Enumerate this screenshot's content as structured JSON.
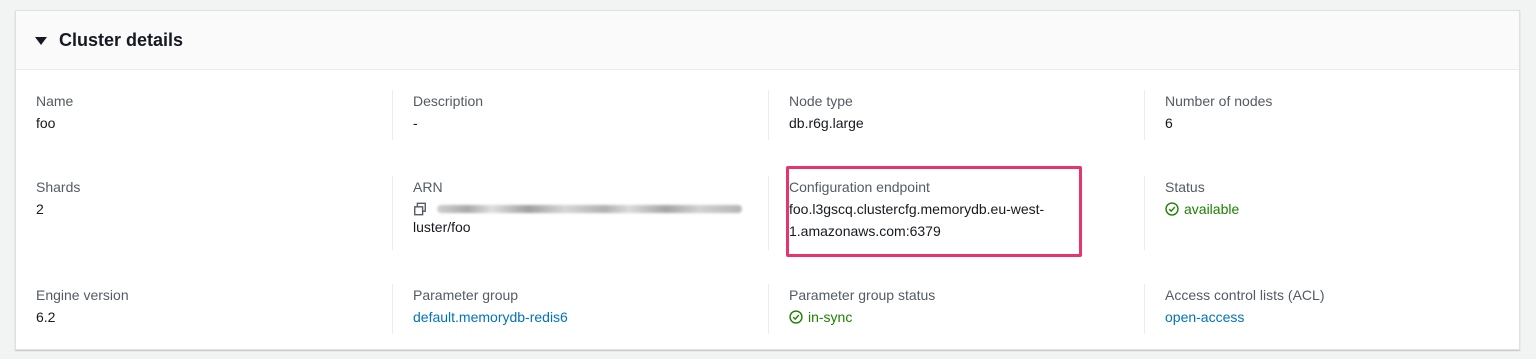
{
  "panel": {
    "title": "Cluster details"
  },
  "fields": {
    "name": {
      "label": "Name",
      "value": "foo"
    },
    "description": {
      "label": "Description",
      "value": "-"
    },
    "node_type": {
      "label": "Node type",
      "value": "db.r6g.large"
    },
    "number_of_nodes": {
      "label": "Number of nodes",
      "value": "6"
    },
    "shards": {
      "label": "Shards",
      "value": "2"
    },
    "arn": {
      "label": "ARN",
      "value_suffix": "luster/foo"
    },
    "configuration_endpoint": {
      "label": "Configuration endpoint",
      "line1": "foo.l3gscq.clustercfg.memorydb.eu-west-",
      "line2": "1.amazonaws.com:6379"
    },
    "status": {
      "label": "Status",
      "value": "available"
    },
    "engine_version": {
      "label": "Engine version",
      "value": "6.2"
    },
    "parameter_group": {
      "label": "Parameter group",
      "value": "default.memorydb-redis6"
    },
    "parameter_group_status": {
      "label": "Parameter group status",
      "value": "in-sync"
    },
    "acl": {
      "label": "Access control lists (ACL)",
      "value": "open-access"
    }
  },
  "icons": {
    "caret": "caret-down-icon",
    "copy": "copy-icon",
    "status": "check-circle-icon"
  },
  "colors": {
    "link": "#0073bb",
    "success": "#1d8102",
    "highlight": "#e8336c"
  }
}
